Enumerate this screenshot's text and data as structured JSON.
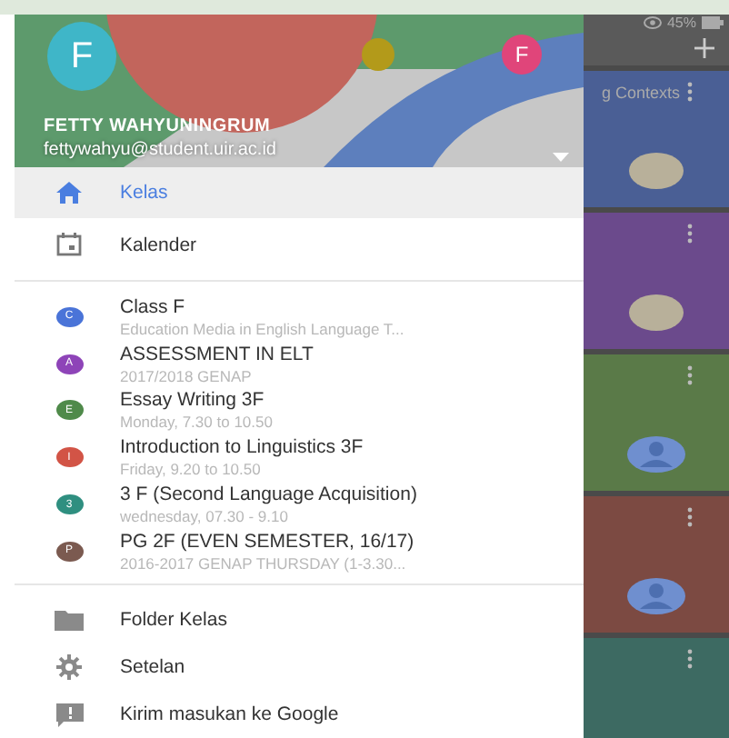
{
  "status_bar": {
    "battery": "45%"
  },
  "account": {
    "initial": "F",
    "other_initial": "F",
    "name": "FETTY WAHYUNINGRUM",
    "email": "fettywahyu@student.uir.ac.id"
  },
  "nav": [
    {
      "kind": "home",
      "label": "Kelas",
      "selected": true
    },
    {
      "kind": "calendar",
      "label": "Kalender",
      "selected": false
    }
  ],
  "classes": [
    {
      "initial": "C",
      "color": "#4a74d8",
      "title": "Class F",
      "subtitle": "Education Media in English Language T...",
      "selected": false
    },
    {
      "initial": "A",
      "color": "#8e44b8",
      "title": "ASSESSMENT IN ELT",
      "subtitle": "2017/2018 GENAP",
      "selected": false
    },
    {
      "initial": "E",
      "color": "#4f8a4a",
      "title": "Essay Writing 3F",
      "subtitle": "Monday, 7.30 to 10.50",
      "selected": false
    },
    {
      "initial": "I",
      "color": "#d25446",
      "title": "Introduction to Linguistics 3F",
      "subtitle": "Friday, 9.20 to 10.50",
      "selected": false
    },
    {
      "initial": "3",
      "color": "#2f8f80",
      "title": "3 F (Second Language Acquisition)",
      "subtitle": "wednesday, 07.30 - 9.10",
      "selected": false
    },
    {
      "initial": "P",
      "color": "#7b5a50",
      "title": "PG 2F (EVEN SEMESTER, 16/17)",
      "subtitle": "2016-2017 GENAP THURSDAY (1-3.30...",
      "selected": false
    }
  ],
  "footer": [
    {
      "kind": "folder",
      "label": "Folder Kelas"
    },
    {
      "kind": "settings",
      "label": "Setelan"
    },
    {
      "kind": "feedback",
      "label": "Kirim masukan ke Google"
    }
  ],
  "background_cards": [
    {
      "color": "#4a5f95",
      "text": "g Contexts",
      "kind": "photo"
    },
    {
      "color": "#6b4a8c",
      "kind": "photo"
    },
    {
      "color": "#5a7a48",
      "kind": "person"
    },
    {
      "color": "#7c4a42",
      "kind": "person"
    },
    {
      "color": "#3d6a62",
      "kind": "plain"
    }
  ]
}
